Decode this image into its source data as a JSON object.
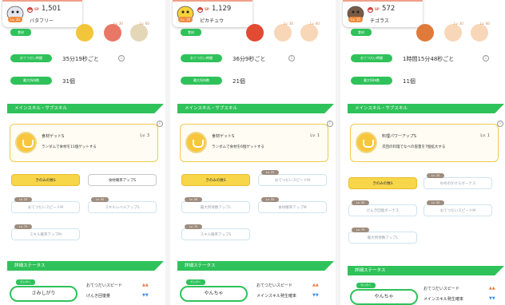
{
  "labels": {
    "sp": "SP",
    "food": "食材",
    "help_time": "おてつだい時間",
    "max_carry": "最大所持数",
    "skills_section": "メインスキル・サブスキル",
    "detail_section": "詳細ステータス",
    "nature_tag": "せいかく",
    "info_icon": "i"
  },
  "panels": [
    {
      "sp": "1,501",
      "level": "Lv. 30",
      "name": "バタフリー",
      "foods": [
        {
          "level": "",
          "color": "#f2c53a"
        },
        {
          "level": "Lv. 30",
          "color": "#e24a33"
        },
        {
          "level": "Lv. 60",
          "color": "#d9c9a0"
        }
      ],
      "help_time": "35分19秒ごと",
      "max_carry": "31個",
      "skill": {
        "name": "食材ゲットS",
        "level": "Lv. 3",
        "desc": "ランダムで食材を11個ゲットする"
      },
      "subskills": [
        {
          "label": "きのみの数S",
          "tag": "",
          "style": "gold"
        },
        {
          "label": "食材確率アップS",
          "tag": "",
          "style": "white"
        },
        {
          "label": "おてつだいスピードM",
          "tag": "Lv. 25",
          "style": "grey"
        },
        {
          "label": "スキルレベルアップS",
          "tag": "Lv. 50",
          "style": "grey"
        },
        {
          "label": "スキル確率アップM",
          "tag": "Lv. 75",
          "style": "grey"
        }
      ],
      "nature": "さみしがり",
      "stats": [
        {
          "label": "おてつだいスピード",
          "arrows": "▲▲",
          "arrow_color": "#e8763a"
        },
        {
          "label": "げんき回復量",
          "arrows": "▼▼",
          "arrow_color": "#3c8ee8"
        }
      ]
    },
    {
      "sp": "1,129",
      "level": "Lv. 19",
      "name": "ピカチュウ",
      "foods": [
        {
          "level": "",
          "color": "#e24a33"
        },
        {
          "level": "Lv. 30",
          "color": "#f4c9a0"
        },
        {
          "level": "Lv. 60",
          "color": "#f4c9a0"
        }
      ],
      "help_time": "36分9秒ごと",
      "max_carry": "21個",
      "skill": {
        "name": "食材ゲットS",
        "level": "Lv. 1",
        "desc": "ランダムで食材を6個ゲットする"
      },
      "subskills": [
        {
          "label": "きのみの数S",
          "tag": "",
          "style": "gold"
        },
        {
          "label": "おてつだいスピードM",
          "tag": "Lv. 25",
          "style": "grey"
        },
        {
          "label": "最大所持数アップL",
          "tag": "Lv. 50",
          "style": "grey"
        },
        {
          "label": "食材確率アップM",
          "tag": "Lv. 50",
          "style": "grey"
        },
        {
          "label": "スキル確率アップS",
          "tag": "Lv. 75",
          "style": "grey"
        }
      ],
      "nature": "やんちゃ",
      "stats": [
        {
          "label": "おてつだいスピード",
          "arrows": "▲▲",
          "arrow_color": "#e8763a"
        },
        {
          "label": "メインスキル発生確率",
          "arrows": "▼▼",
          "arrow_color": "#3c8ee8"
        }
      ]
    },
    {
      "sp": "572",
      "level": "Lv. 15",
      "name": "チゴラス",
      "foods": [
        {
          "level": "",
          "color": "#e07a3a"
        },
        {
          "level": "Lv. 30",
          "color": "#f4c9a0"
        },
        {
          "level": "Lv. 60",
          "color": "#f4c9a0"
        }
      ],
      "help_time": "1時間15分48秒ごと",
      "max_carry": "11個",
      "skill": {
        "name": "料理パワーアップS",
        "level": "Lv. 1",
        "desc": "次回の料理でなべの容量を7個拡大する"
      },
      "subskills": [
        {
          "label": "きのみの数S",
          "tag": "",
          "style": "gold"
        },
        {
          "label": "ゆめのかけらボーナス",
          "tag": "Lv. 25",
          "style": "grey"
        },
        {
          "label": "げんき回復ボーナス",
          "tag": "Lv. 50",
          "style": "grey"
        },
        {
          "label": "おてつだいスピードM",
          "tag": "Lv. 50",
          "style": "grey"
        },
        {
          "label": "最大所持数アップL",
          "tag": "Lv. 75",
          "style": "grey"
        }
      ],
      "nature": "やんちゃ",
      "stats": [
        {
          "label": "おてつだいスピード",
          "arrows": "▲▲",
          "arrow_color": "#e8763a"
        },
        {
          "label": "メインスキル発生確率",
          "arrows": "▼▼",
          "arrow_color": "#3c8ee8"
        }
      ]
    }
  ]
}
